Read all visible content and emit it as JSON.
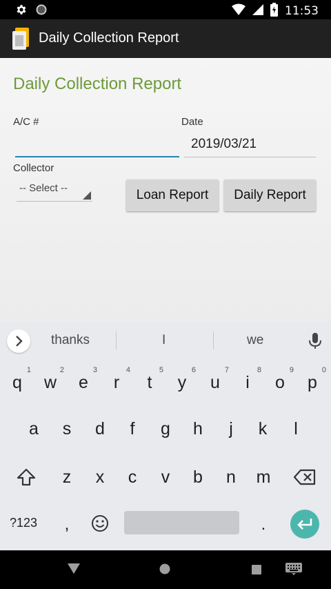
{
  "status_bar": {
    "time": "11:53"
  },
  "app_bar": {
    "title": "Daily Collection Report"
  },
  "form": {
    "heading": "Daily Collection Report",
    "ac_label": "A/C #",
    "ac_value": "",
    "date_label": "Date",
    "date_value": "2019/03/21",
    "collector_label": "Collector",
    "collector_selected": "-- Select --",
    "loan_report_button": "Loan Report",
    "daily_report_button": "Daily Report"
  },
  "keyboard": {
    "suggestions": [
      "thanks",
      "I",
      "we"
    ],
    "row1": [
      {
        "k": "q",
        "n": "1"
      },
      {
        "k": "w",
        "n": "2"
      },
      {
        "k": "e",
        "n": "3"
      },
      {
        "k": "r",
        "n": "4"
      },
      {
        "k": "t",
        "n": "5"
      },
      {
        "k": "y",
        "n": "6"
      },
      {
        "k": "u",
        "n": "7"
      },
      {
        "k": "i",
        "n": "8"
      },
      {
        "k": "o",
        "n": "9"
      },
      {
        "k": "p",
        "n": "0"
      }
    ],
    "row2": [
      "a",
      "s",
      "d",
      "f",
      "g",
      "h",
      "j",
      "k",
      "l"
    ],
    "row3": [
      "z",
      "x",
      "c",
      "v",
      "b",
      "n",
      "m"
    ],
    "symbols_key": "?123",
    "comma_key": ",",
    "period_key": "."
  },
  "colors": {
    "accent_green": "#6d9a3a",
    "input_focus": "#1e88a8",
    "enter_key": "#4db6ac"
  }
}
